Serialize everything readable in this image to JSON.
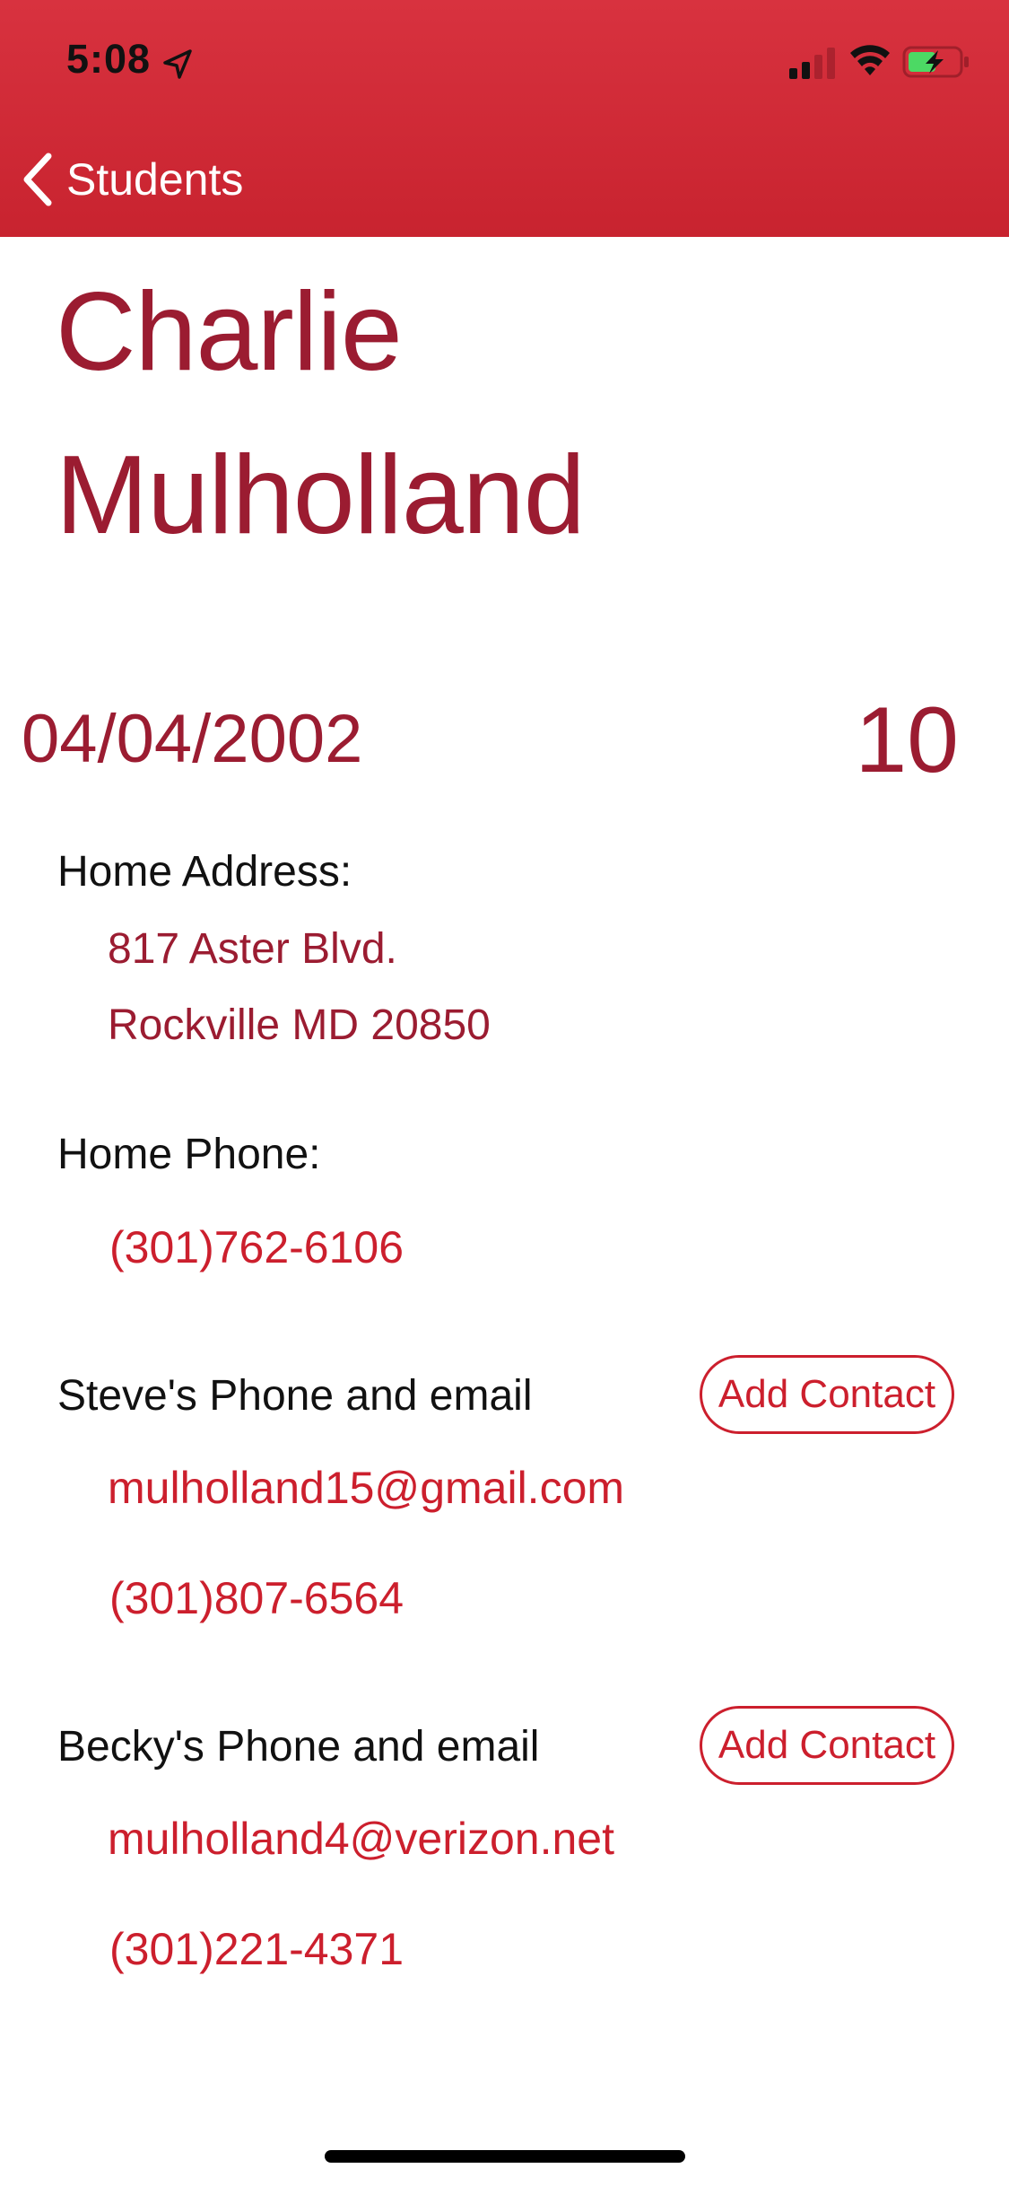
{
  "status_bar": {
    "time": "5:08",
    "icons": [
      "location-arrow-icon",
      "cellular-signal-icon",
      "wifi-icon",
      "battery-charging-icon"
    ]
  },
  "nav": {
    "back_label": "Students",
    "back_icon": "chevron-left-icon"
  },
  "student": {
    "first_name": "Charlie",
    "last_name": "Mulholland",
    "birthdate": "04/04/2002",
    "grade": "10"
  },
  "home_address": {
    "label": "Home Address:",
    "line1": "817 Aster Blvd.",
    "line2": "Rockville MD 20850"
  },
  "home_phone": {
    "label": "Home Phone:",
    "number": "(301)762-6106"
  },
  "contacts": [
    {
      "label": "Steve's Phone and email",
      "email": "mulholland15@gmail.com",
      "phone": "(301)807-6564",
      "add_label": "Add Contact"
    },
    {
      "label": "Becky's Phone and email",
      "email": "mulholland4@verizon.net",
      "phone": "(301)221-4371",
      "add_label": "Add Contact"
    }
  ],
  "colors": {
    "header_red": "#cf2a36",
    "title_maroon": "#9b1c31",
    "link_red": "#cc1f2d",
    "battery_green": "#4cd964"
  }
}
